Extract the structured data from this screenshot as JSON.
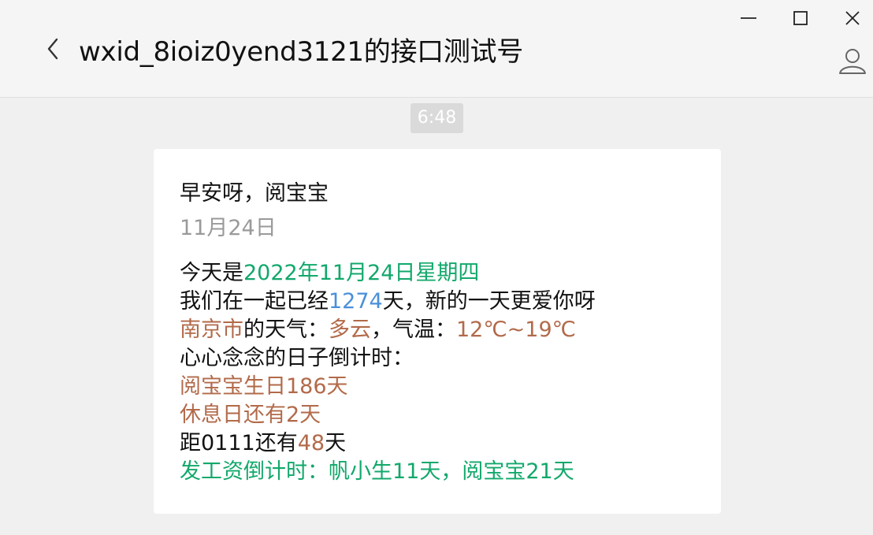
{
  "window": {
    "title": "wxid_8ioiz0yend3121的接口测试号",
    "controls": {
      "minimize": "minimize",
      "maximize": "maximize",
      "close": "close"
    }
  },
  "chat": {
    "timestamp": "6:48",
    "message": {
      "greeting": "早安呀，阅宝宝",
      "date_short": "11月24日",
      "line1": {
        "prefix": "今天是",
        "date": "2022年11月24日星期四"
      },
      "line2": {
        "prefix": "我们在一起已经",
        "days": "1274",
        "suffix": "天，新的一天更爱你呀"
      },
      "line3": {
        "city": "南京市",
        "mid": "的天气：",
        "weather": "多云",
        "mid2": "，气温：",
        "temp": "12℃~19℃"
      },
      "line4": "心心念念的日子倒计时：",
      "line5": "阅宝宝生日186天",
      "line6": "休息日还有2天",
      "line7": {
        "prefix": "距0111还有",
        "days": "48",
        "suffix": "天"
      },
      "line8": "发工资倒计时：帆小生11天，阅宝宝21天"
    }
  },
  "colors": {
    "green": "#12a86b",
    "blue": "#4a90d9",
    "brown": "#b26a4a",
    "gray": "#9a9a9a"
  },
  "icons": [
    "chevron-left-icon",
    "minimize-icon",
    "maximize-icon",
    "close-icon",
    "user-profile-icon"
  ]
}
